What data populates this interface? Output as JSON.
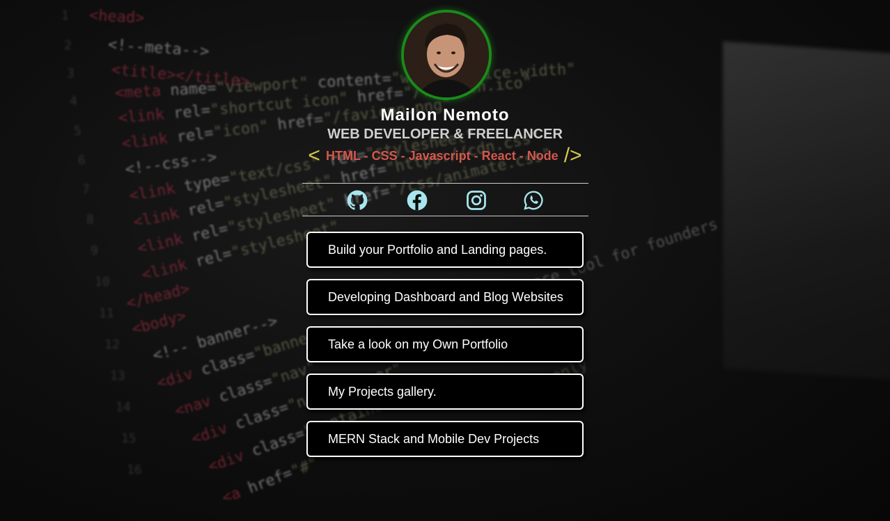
{
  "profile": {
    "name": "Mailon Nemoto",
    "title": "WEB DEVELOPER & FREELANCER",
    "stack_open": "<",
    "stack": "HTML - CSS - Javascript - React - Node",
    "stack_close": "/>"
  },
  "social": [
    {
      "icon": "github-icon"
    },
    {
      "icon": "facebook-icon"
    },
    {
      "icon": "instagram-icon"
    },
    {
      "icon": "whatsapp-icon"
    }
  ],
  "links": [
    {
      "label": "Build your Portfolio and Landing pages."
    },
    {
      "label": "Developing Dashboard and Blog Websites"
    },
    {
      "label": "Take a look on my Own Portfolio"
    },
    {
      "label": "My Projects gallery."
    },
    {
      "label": "MERN Stack and Mobile Dev Projects"
    }
  ],
  "colors": {
    "icon": "#a8e6ee",
    "avatar_ring": "#1a8a1a",
    "bracket": "#d9c84a",
    "stack_text": "#d4574c"
  }
}
